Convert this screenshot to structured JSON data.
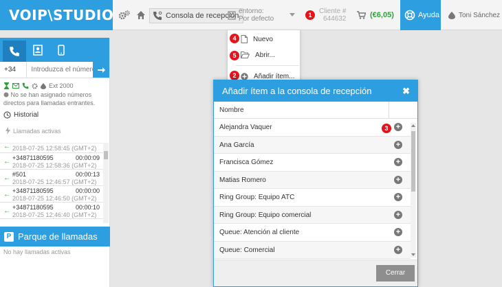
{
  "app": {
    "logo": "VOIP\\STUDIO"
  },
  "topbar": {
    "consola_label": "Consola de recepción",
    "entorno_label": "entorno:",
    "entorno_value": "Por defecto",
    "cliente_label": "Cliente #",
    "cliente_value": "644632",
    "credit": "(€6,05)",
    "help_label": "Ayuda",
    "user_name": "Toni Sánchez"
  },
  "colors": {
    "accent": "#2d9fe0",
    "accent_dark": "#1f7fbf",
    "badge": "#e3141b",
    "credit": "#2f9f3a",
    "button_gray": "#8e8e8e"
  },
  "badges": [
    "1",
    "2",
    "3",
    "4",
    "5"
  ],
  "dropdown": {
    "items": [
      {
        "label": "Nuevo",
        "icon": "file-icon"
      },
      {
        "label": "Abrir...",
        "icon": "folder-open-icon"
      },
      {
        "label": "Añadir ítem...",
        "icon": "plus-circle-icon"
      }
    ]
  },
  "leftpanel": {
    "prefix": "+34",
    "dial_placeholder": "Introduzca el número",
    "extension": "Ext 2000",
    "no_numbers_text": "No se han asignado números directos para llamadas entrantes.",
    "historial": "Historial",
    "active_calls": "Llamadas activas",
    "calls": [
      {
        "number": "",
        "duration": "",
        "time": "2018-07-25 12:58:45 (GMT+2)"
      },
      {
        "number": "+34871180595",
        "duration": "00:00:09",
        "time": "2018-07-25 12:58:36 (GMT+2)"
      },
      {
        "number": "#501",
        "duration": "00:00:13",
        "time": "2018-07-25 12:46:57 (GMT+2)"
      },
      {
        "number": "+34871180595",
        "duration": "00:00:00",
        "time": "2018-07-25 12:46:50 (GMT+2)"
      },
      {
        "number": "+34871180595",
        "duration": "00:00:10",
        "time": "2018-07-25 12:46:40 (GMT+2)"
      }
    ],
    "parking_title": "Parque de llamadas",
    "parking_letter": "P",
    "no_parking": "No hay llamadas activas"
  },
  "modal": {
    "title": "Añadir ítem a la consola de recepción",
    "close": "✖",
    "column_name": "Nombre",
    "rows": [
      "Alejandra Vaquer",
      "Ana García",
      "Francisca Gómez",
      "Matias Romero",
      "Ring Group: Equipo ATC",
      "Ring Group: Equipo comercial",
      "Queue: Atención al cliente",
      "Queue: Comercial"
    ],
    "close_button": "Cerrar"
  }
}
